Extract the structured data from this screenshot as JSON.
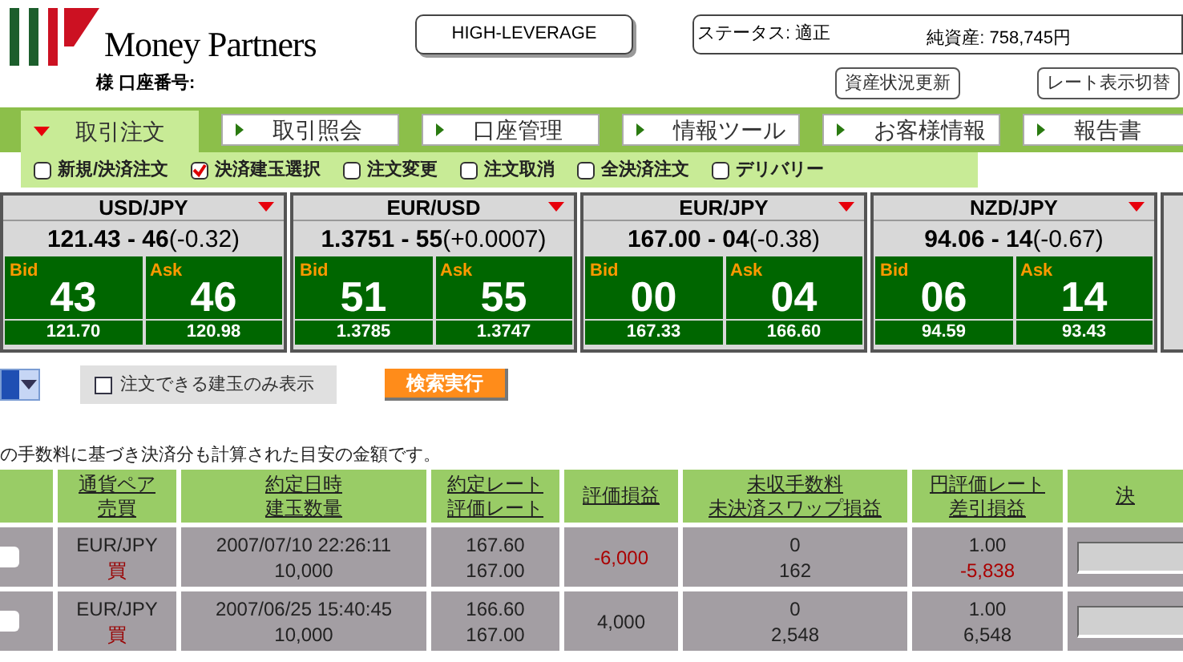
{
  "logo": {
    "brand": "Money Partners"
  },
  "account": {
    "honorific": "様",
    "label": "口座番号:"
  },
  "mode_button": "HIGH-LEVERAGE",
  "status": {
    "status": "ステータス: 適正",
    "net_assets": "純資産: 758,745円"
  },
  "header_buttons": [
    "資産状況更新",
    "レート表示切替"
  ],
  "nav_tabs": [
    {
      "label": "取引注文",
      "selected": true
    },
    {
      "label": "取引照会",
      "selected": false
    },
    {
      "label": "口座管理",
      "selected": false
    },
    {
      "label": "情報ツール",
      "selected": false
    },
    {
      "label": "お客様情報",
      "selected": false
    },
    {
      "label": "報告書",
      "selected": false
    }
  ],
  "sub_options": [
    {
      "label": "新規/決済注文",
      "selected": false
    },
    {
      "label": "決済建玉選択",
      "selected": true
    },
    {
      "label": "注文変更",
      "selected": false
    },
    {
      "label": "注文取消",
      "selected": false
    },
    {
      "label": "全決済注文",
      "selected": false
    },
    {
      "label": "デリバリー",
      "selected": false
    }
  ],
  "rates": [
    {
      "pair": "USD/JPY",
      "quote": "121.43 - 46",
      "change": "(-0.32)",
      "bid_label": "Bid",
      "bid": "43",
      "ask_label": "Ask",
      "ask": "46",
      "bid_sub": "121.70",
      "ask_sub": "120.98"
    },
    {
      "pair": "EUR/USD",
      "quote": "1.3751 - 55",
      "change": "(+0.0007)",
      "bid_label": "Bid",
      "bid": "51",
      "ask_label": "Ask",
      "ask": "55",
      "bid_sub": "1.3785",
      "ask_sub": "1.3747"
    },
    {
      "pair": "EUR/JPY",
      "quote": "167.00 - 04",
      "change": "(-0.38)",
      "bid_label": "Bid",
      "bid": "00",
      "ask_label": "Ask",
      "ask": "04",
      "bid_sub": "167.33",
      "ask_sub": "166.60"
    },
    {
      "pair": "NZD/JPY",
      "quote": "94.06 - 14",
      "change": "(-0.67)",
      "bid_label": "Bid",
      "bid": "06",
      "ask_label": "Ask",
      "ask": "14",
      "bid_sub": "94.59",
      "ask_sub": "93.43"
    }
  ],
  "filter": {
    "checkbox_label": "注文できる建玉のみ表示",
    "checked": false,
    "search_button": "検索実行"
  },
  "note": "の手数料に基づき決済分も計算された目安の金額です。",
  "table": {
    "columns": [
      [
        "通貨ペア",
        "売買"
      ],
      [
        "約定日時",
        "建玉数量"
      ],
      [
        "約定レート",
        "評価レート"
      ],
      [
        "評価損益"
      ],
      [
        "未収手数料",
        "未決済スワップ損益"
      ],
      [
        "円評価レート",
        "差引損益"
      ],
      [
        "決"
      ]
    ],
    "rows": [
      {
        "checked": false,
        "pair": "EUR/JPY",
        "side": "買",
        "date": "2007/07/10 22:26:11",
        "quantity": "10,000",
        "contract_rate": "167.60",
        "valuation_rate": "167.00",
        "pl": "-6,000",
        "pl_negative": true,
        "fee": "0",
        "swap": "162",
        "yen_rate": "1.00",
        "net_pl": "-5,838",
        "net_negative": true
      },
      {
        "checked": false,
        "pair": "EUR/JPY",
        "side": "買",
        "date": "2007/06/25 15:40:45",
        "quantity": "10,000",
        "contract_rate": "166.60",
        "valuation_rate": "167.00",
        "pl": "4,000",
        "pl_negative": false,
        "fee": "0",
        "swap": "2,548",
        "yen_rate": "1.00",
        "net_pl": "6,548",
        "net_negative": false
      }
    ]
  }
}
